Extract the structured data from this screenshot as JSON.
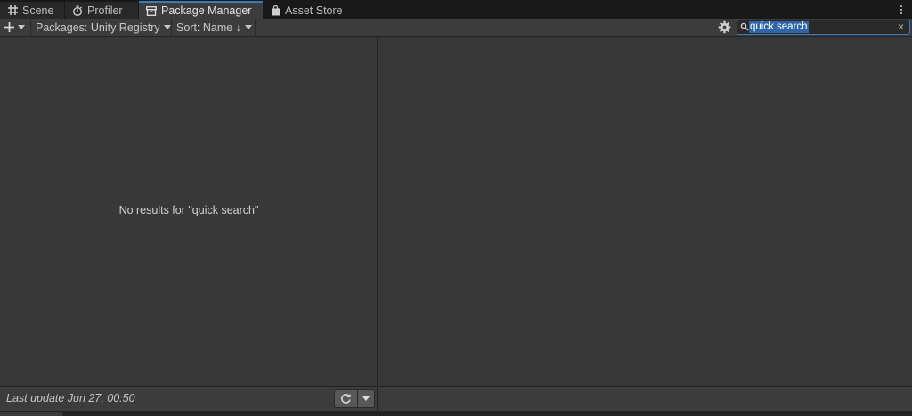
{
  "tabs": [
    {
      "label": "Scene",
      "icon": "grid-icon"
    },
    {
      "label": "Profiler",
      "icon": "stopwatch-icon"
    },
    {
      "label": "Package Manager",
      "icon": "package-icon"
    },
    {
      "label": "Asset Store",
      "icon": "shopping-bag-icon"
    }
  ],
  "toolbar": {
    "packages_label": "Packages: Unity Registry",
    "sort_label": "Sort: Name ↓"
  },
  "search": {
    "value": "quick search",
    "clear_glyph": "×"
  },
  "list": {
    "empty_message": "No results for \"quick search\""
  },
  "footer": {
    "last_update": "Last update Jun 27, 00:50"
  },
  "colors": {
    "accent": "#3a79bb",
    "selection": "#2f65a8",
    "panel": "#383838",
    "toolbar": "#3c3c3c"
  }
}
